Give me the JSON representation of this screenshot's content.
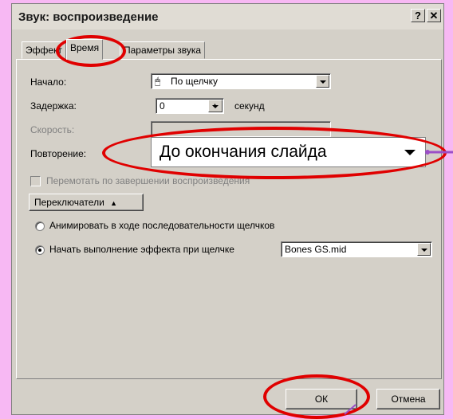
{
  "window": {
    "title": "Звук: воспроизведение",
    "help_label": "?",
    "close_label": "✕"
  },
  "tabs": [
    {
      "label": "Эффект"
    },
    {
      "label": "Время"
    },
    {
      "label": "Параметры звука"
    }
  ],
  "timing": {
    "start_label": "Начало:",
    "start_value": "По щелчку",
    "delay_label": "Задержка:",
    "delay_value": "0",
    "delay_unit": "секунд",
    "speed_label": "Скорость:",
    "speed_value": "",
    "repeat_label": "Повторение:",
    "repeat_value": "До окончания слайда",
    "rewind_label": "Перемотать по завершении воспроизведения",
    "rewind_checked": false,
    "triggers_label": "Переключатели",
    "animate_in_sequence_label": "Анимировать в ходе последовательности щелчков",
    "start_on_click_label": "Начать выполнение эффекта при щелчке",
    "trigger_selected": "start_on_click",
    "trigger_object_value": "Bones GS.mid"
  },
  "buttons": {
    "ok_label": "ОК",
    "cancel_label": "Отмена"
  },
  "colors": {
    "background": "#f7b8f3",
    "highlight": "#e00000",
    "pointer_line": "#9b4fc7"
  },
  "icons": {
    "start_icon": "mouse-pointer-icon",
    "triggers_icon": "double-chevron-up-icon"
  }
}
